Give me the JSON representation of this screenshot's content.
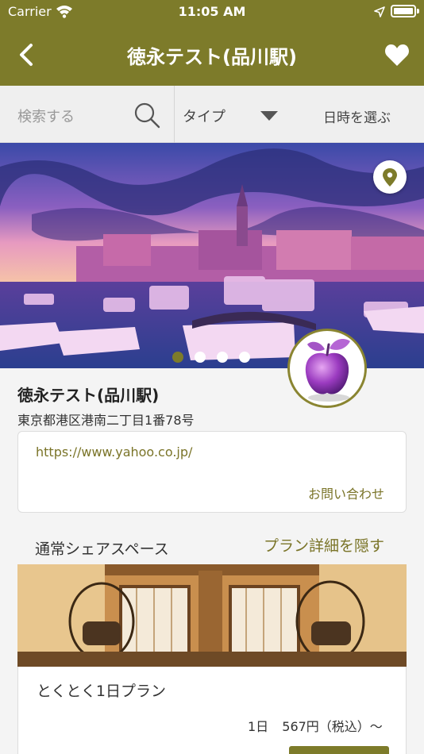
{
  "status_bar": {
    "carrier": "Carrier",
    "time": "11:05 AM"
  },
  "header": {
    "title": "徳永テスト(品川駅)",
    "color": "#7d7b2a"
  },
  "search": {
    "placeholder": "検索する",
    "type_label": "タイプ",
    "date_label": "日時を選ぶ"
  },
  "hero": {
    "slide_count": 4,
    "active_slide": 0
  },
  "place": {
    "name": "徳永テスト(品川駅)",
    "address": "東京都港区港南二丁目1番78号",
    "url": "https://www.yahoo.co.jp/",
    "contact_label": "お問い合わせ"
  },
  "plans_section": {
    "title": "通常シェアスペース",
    "toggle_label": "プラン詳細を隠す"
  },
  "plan": {
    "name": "とくとく1日プラン",
    "price": "1日 567円（税込）～"
  },
  "icons": [
    "back-chevron-icon",
    "heart-icon",
    "search-icon",
    "caret-down-icon",
    "map-pin-icon",
    "wifi-icon",
    "location-arrow-icon",
    "battery-icon"
  ]
}
